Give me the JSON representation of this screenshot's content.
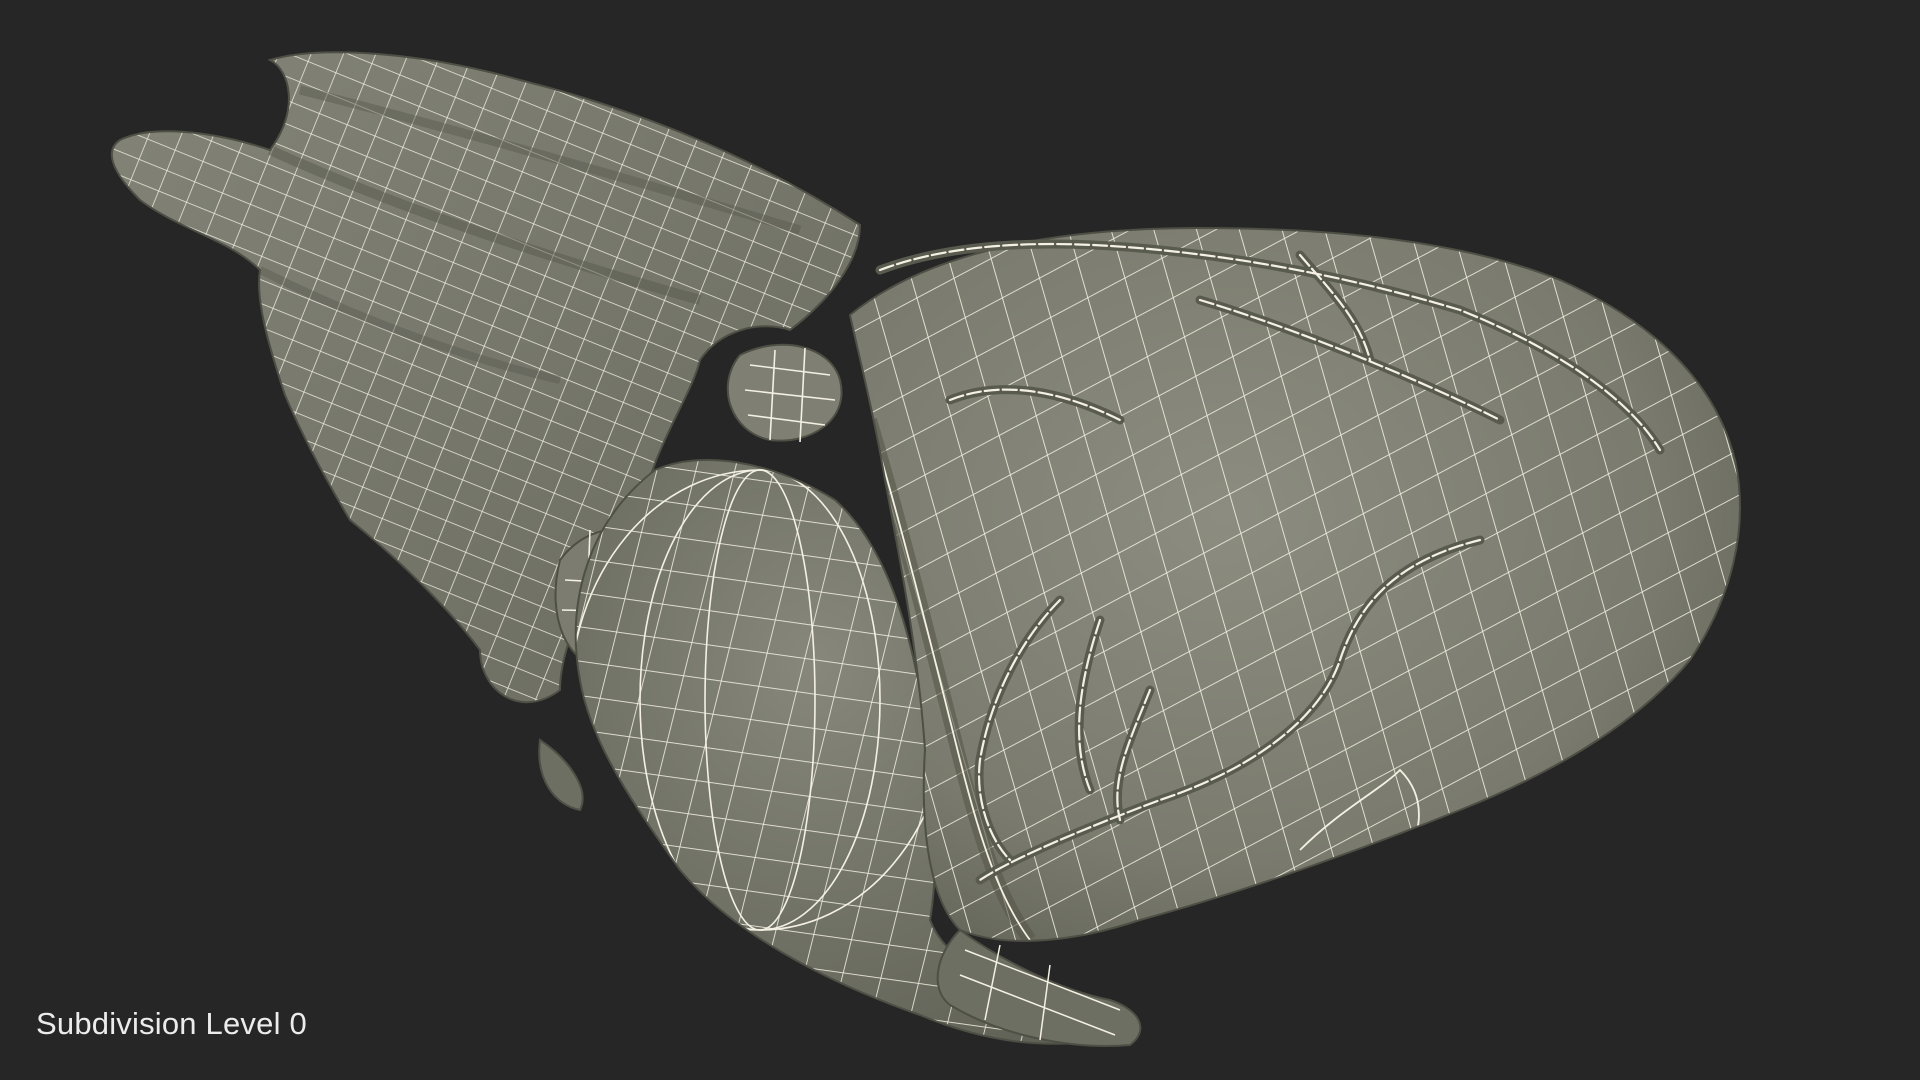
{
  "viewport": {
    "background": "#262626",
    "caption": "Subdivision Level 0"
  },
  "model": {
    "subject": "heart-3d-model",
    "display_mode": "wireframe-on-shaded",
    "surface_color": "#7d7e71",
    "wire_color": "#f4f1e4"
  }
}
